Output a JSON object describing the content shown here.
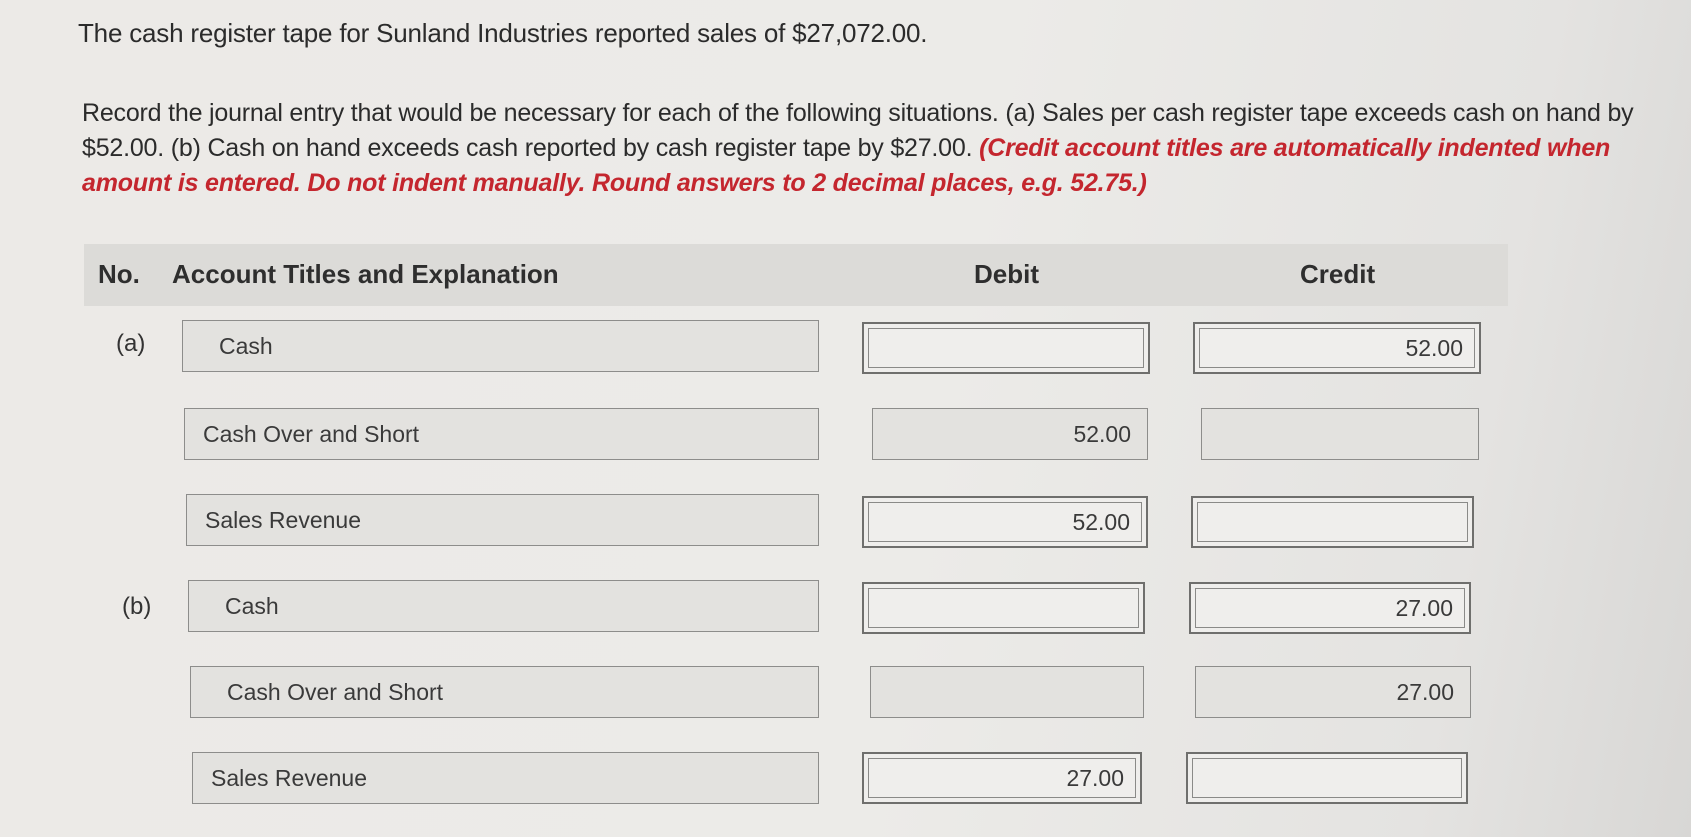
{
  "question": {
    "intro": "The cash register tape for Sunland Industries reported sales of $27,072.00.",
    "instruction": "Record the journal entry that would be necessary for each of the following situations. (a) Sales per cash register tape exceeds cash on hand by $52.00. (b) Cash on hand exceeds cash reported by cash register tape by $27.00.",
    "note": "(Credit account titles are automatically indented when amount is entered. Do not indent manually. Round answers to 2 decimal places, e.g. 52.75.)"
  },
  "table": {
    "headers": {
      "no": "No.",
      "account": "Account Titles and Explanation",
      "debit": "Debit",
      "credit": "Credit"
    },
    "entries": [
      {
        "label": "(a)",
        "rows": [
          {
            "account": "Cash",
            "debit": "",
            "credit": "52.00"
          },
          {
            "account": "Cash Over and Short",
            "debit": "52.00",
            "credit": ""
          },
          {
            "account": "Sales Revenue",
            "debit": "52.00",
            "credit": ""
          }
        ]
      },
      {
        "label": "(b)",
        "rows": [
          {
            "account": "Cash",
            "debit": "",
            "credit": "27.00"
          },
          {
            "account": "Cash Over and Short",
            "debit": "",
            "credit": "27.00"
          },
          {
            "account": "Sales Revenue",
            "debit": "27.00",
            "credit": ""
          }
        ]
      }
    ]
  },
  "colors": {
    "note_red": "#c4262e",
    "header_bg": "#dcdbd8",
    "field_bg": "#e3e2df"
  }
}
